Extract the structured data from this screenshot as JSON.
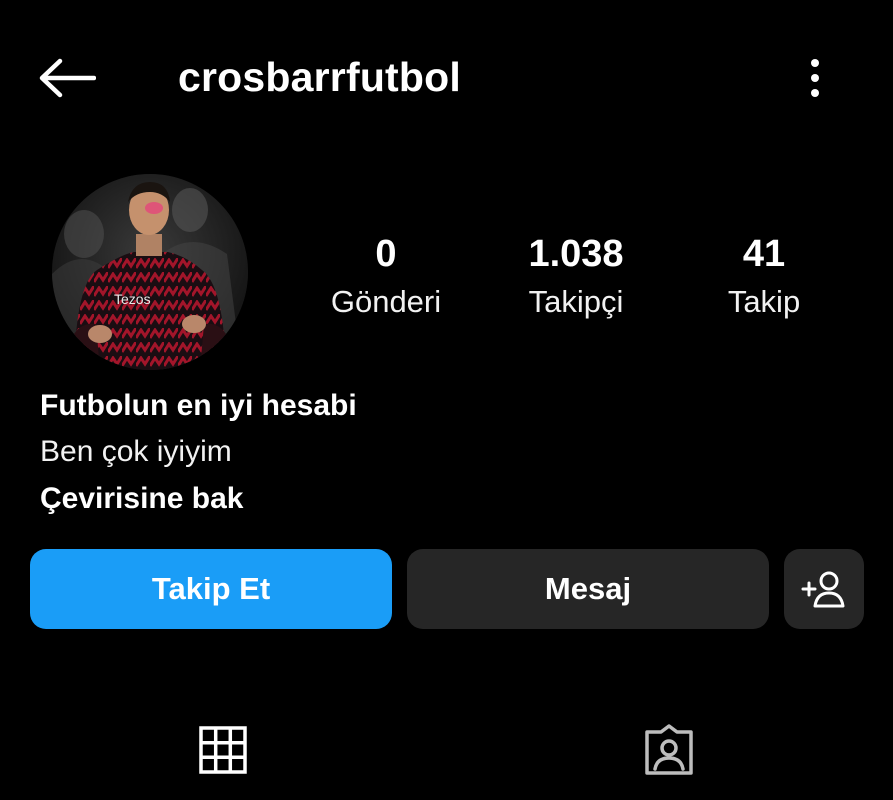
{
  "header": {
    "username": "crosbarrfutbol",
    "back_icon": "arrow-left-icon",
    "more_icon": "more-vertical-icon"
  },
  "profile": {
    "avatar_badge": "Tezos"
  },
  "stats": [
    {
      "value": "0",
      "label": "Gönderi"
    },
    {
      "value": "1.038",
      "label": "Takipçi"
    },
    {
      "value": "41",
      "label": "Takip"
    }
  ],
  "bio": {
    "name": "Futbolun en iyi hesabi",
    "text": "Ben çok iyiyim",
    "translate_link": "Çevirisine bak"
  },
  "actions": {
    "follow_label": "Takip Et",
    "message_label": "Mesaj",
    "suggest_icon": "add-person-icon"
  },
  "tabs": [
    {
      "icon": "grid-icon"
    },
    {
      "icon": "tagged-person-icon"
    }
  ],
  "colors": {
    "background": "#000000",
    "accent": "#1a9df7",
    "secondary_button": "#262626",
    "text": "#ffffff"
  }
}
